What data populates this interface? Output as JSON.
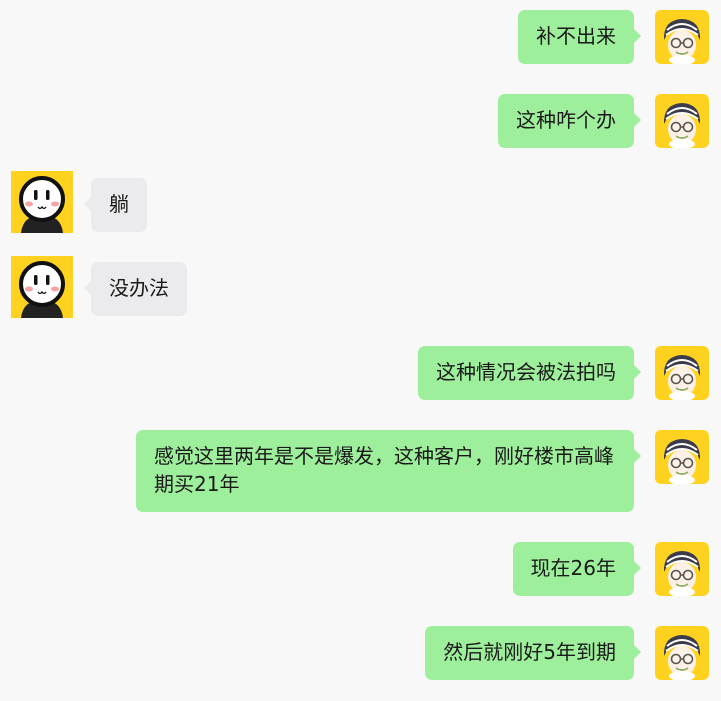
{
  "messages": [
    {
      "side": "right",
      "text": "补不出来"
    },
    {
      "side": "right",
      "text": "这种咋个办"
    },
    {
      "side": "left",
      "text": "躺"
    },
    {
      "side": "left",
      "text": "没办法"
    },
    {
      "side": "right",
      "text": "这种情况会被法拍吗"
    },
    {
      "side": "right",
      "text": "感觉这里两年是不是爆发，这种客户，刚好楼市高峰期买21年"
    },
    {
      "side": "right",
      "text": "现在26年"
    },
    {
      "side": "right",
      "text": "然后就刚好5年到期"
    }
  ],
  "colors": {
    "background": "#f8f8f8",
    "outgoing_bubble": "#9eef9c",
    "incoming_bubble": "#ebebed",
    "avatar_bg": "#ffd21f"
  },
  "icons": {
    "self_avatar": "grandpa-with-glasses-avatar-icon",
    "contact_avatar": "smiley-face-avatar-icon"
  }
}
